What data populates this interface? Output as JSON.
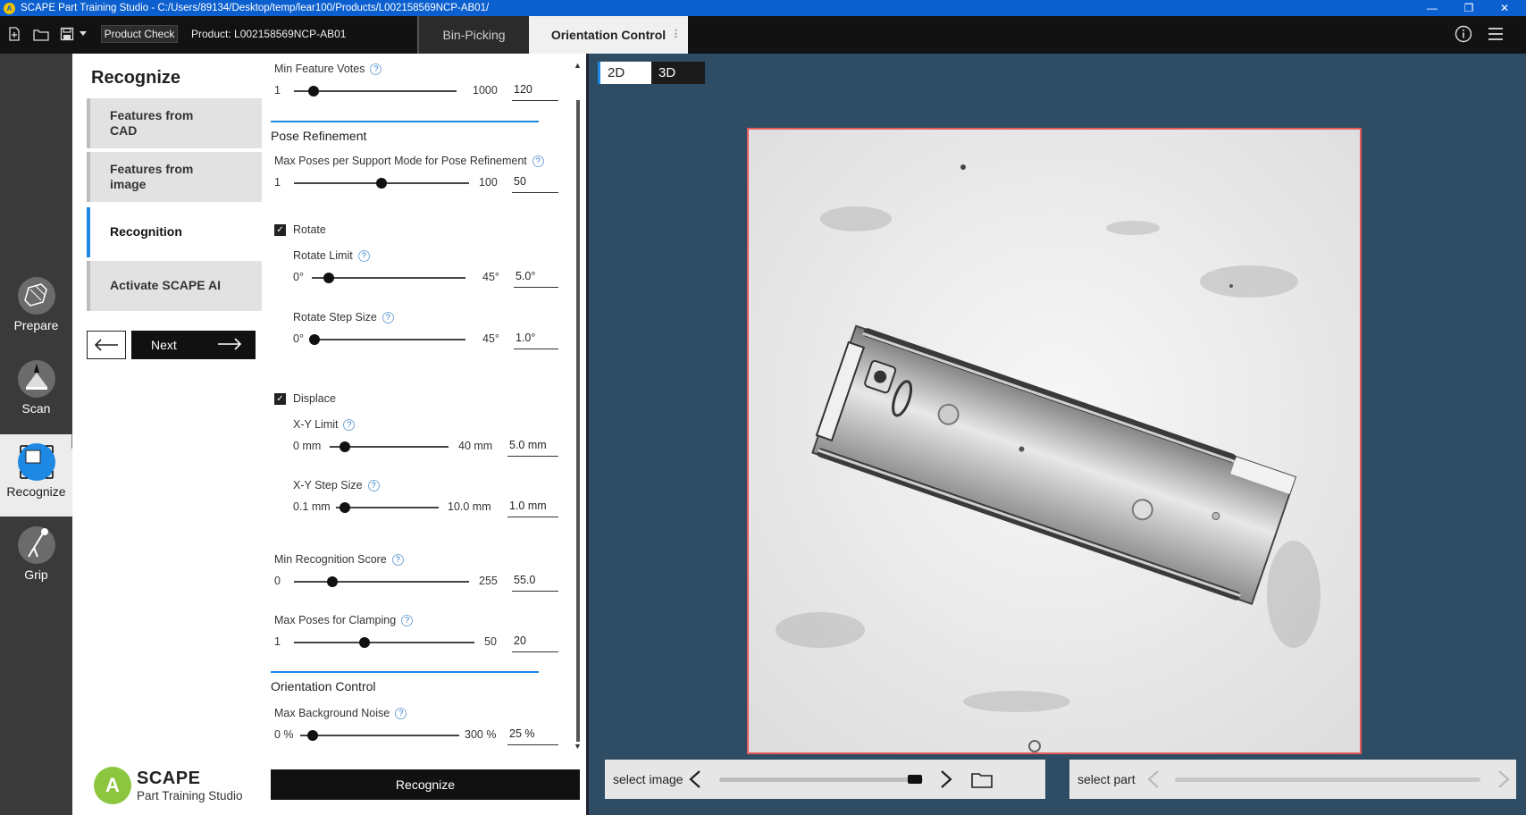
{
  "window": {
    "title": "SCAPE Part Training Studio - C:/Users/89134/Desktop/temp/lear100/Products/L002158569NCP-AB01/",
    "controls": [
      "minimize",
      "restore",
      "close"
    ]
  },
  "toolbar": {
    "product_check_label": "Product Check",
    "product_label": "Product: L002158569NCP-AB01",
    "tabs": [
      "Bin-Picking",
      "Orientation Control"
    ]
  },
  "rail": {
    "items": [
      {
        "label": "Prepare",
        "icon": "prepare-icon"
      },
      {
        "label": "Scan",
        "icon": "scan-icon"
      },
      {
        "label": "Recognize",
        "icon": "recognize-icon",
        "active": true
      },
      {
        "label": "Grip",
        "icon": "grip-icon"
      }
    ]
  },
  "sidebar": {
    "title": "Recognize",
    "steps": [
      {
        "label": "Features from CAD"
      },
      {
        "label": "Features from image"
      },
      {
        "label": "Recognition",
        "active": true
      },
      {
        "label": "Activate SCAPE AI"
      }
    ],
    "next_label": "Next",
    "logo_name": "SCAPE",
    "logo_subtitle": "Part Training Studio"
  },
  "params": {
    "min_feature_votes": {
      "label": "Min Feature Votes",
      "min": "1",
      "max": "1000",
      "value": "120",
      "level": 0.12
    },
    "pose_refinement_section": "Pose Refinement",
    "max_poses_support": {
      "label": "Max Poses per Support Mode for Pose Refinement",
      "min": "1",
      "max": "100",
      "value": "50",
      "level": 0.5
    },
    "rotate_label": "Rotate",
    "rotate_limit": {
      "label": "Rotate Limit",
      "min": "0°",
      "max": "45°",
      "value": "5.0°",
      "level": 0.11
    },
    "rotate_step": {
      "label": "Rotate Step Size",
      "min": "0°",
      "max": "45°",
      "value": "1.0°",
      "level": 0.02
    },
    "displace_label": "Displace",
    "xy_limit": {
      "label": "X-Y Limit",
      "min": "0 mm",
      "max": "40 mm",
      "value": "5.0 mm",
      "level": 0.125
    },
    "xy_step": {
      "label": "X-Y Step Size",
      "min": "0.1 mm",
      "max": "10.0 mm",
      "value": "1.0 mm",
      "level": 0.09
    },
    "min_recognition_score": {
      "label": "Min Recognition Score",
      "min": "0",
      "max": "255",
      "value": "55.0",
      "level": 0.22
    },
    "max_poses_clamping": {
      "label": "Max Poses for Clamping",
      "min": "1",
      "max": "50",
      "value": "20",
      "level": 0.39
    },
    "orientation_section": "Orientation Control",
    "max_background_noise": {
      "label": "Max Background Noise",
      "min": "0 %",
      "max": "300 %",
      "value": "25 %",
      "level": 0.08
    },
    "recognize_button": "Recognize"
  },
  "viewer": {
    "toggle": [
      "2D",
      "3D"
    ],
    "active_view": "2D",
    "select_image_label": "select image",
    "select_part_label": "select part",
    "image_slider_level": 0.96
  },
  "colors": {
    "accent": "#1e88e5",
    "titlebar": "#0b5fcf",
    "viewer_bg": "#2e4d64",
    "image_border": "#e55a5a"
  }
}
